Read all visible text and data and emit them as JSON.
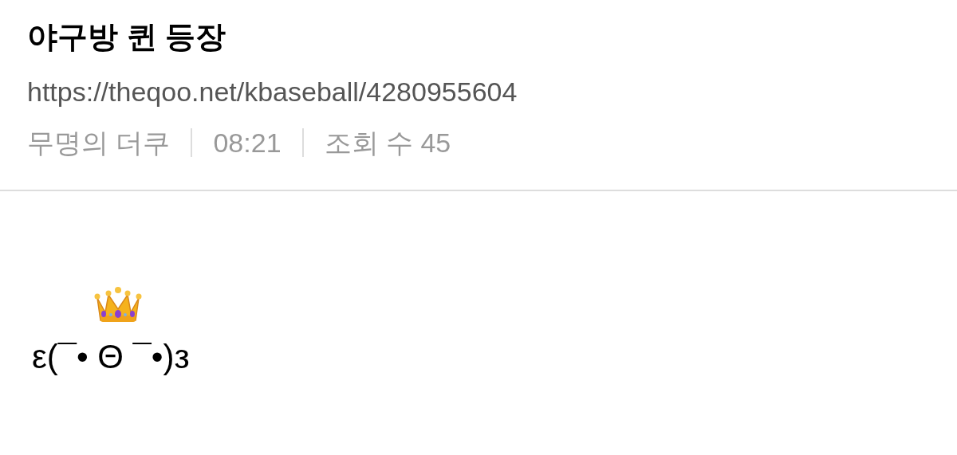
{
  "post": {
    "title": "야구방 퀸 등장",
    "url": "https://theqoo.net/kbaseball/4280955604",
    "meta": [
      "무명의 더쿠",
      "08:21",
      "조회 수 45"
    ]
  },
  "body": {
    "lines": [
      "ε(¯• Θ ¯•)з"
    ]
  }
}
